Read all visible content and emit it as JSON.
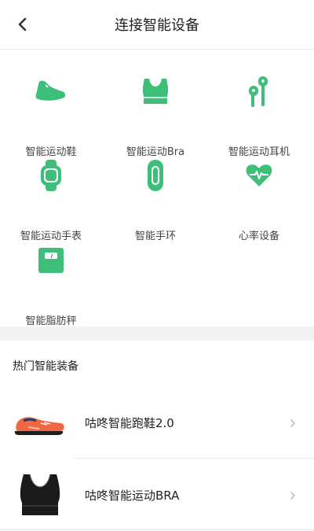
{
  "header": {
    "title": "连接智能设备",
    "back_icon": "chevron-left-icon"
  },
  "accent": "#3dbf79",
  "devices": [
    {
      "label": "智能运动鞋",
      "icon": "sneaker-icon"
    },
    {
      "label": "智能运动Bra",
      "icon": "sports-bra-icon"
    },
    {
      "label": "智能运动耳机",
      "icon": "earphones-icon"
    },
    {
      "label": "智能运动手表",
      "icon": "smartwatch-icon"
    },
    {
      "label": "智能手环",
      "icon": "wristband-icon"
    },
    {
      "label": "心率设备",
      "icon": "heart-rate-icon"
    },
    {
      "label": "智能脂肪秤",
      "icon": "scale-icon"
    }
  ],
  "hot": {
    "title": "热门智能装备",
    "items": [
      {
        "name": "咕咚智能跑鞋2.0",
        "image": "running-shoe-image"
      },
      {
        "name": "咕咚智能运动BRA",
        "image": "sports-bra-image"
      }
    ]
  }
}
